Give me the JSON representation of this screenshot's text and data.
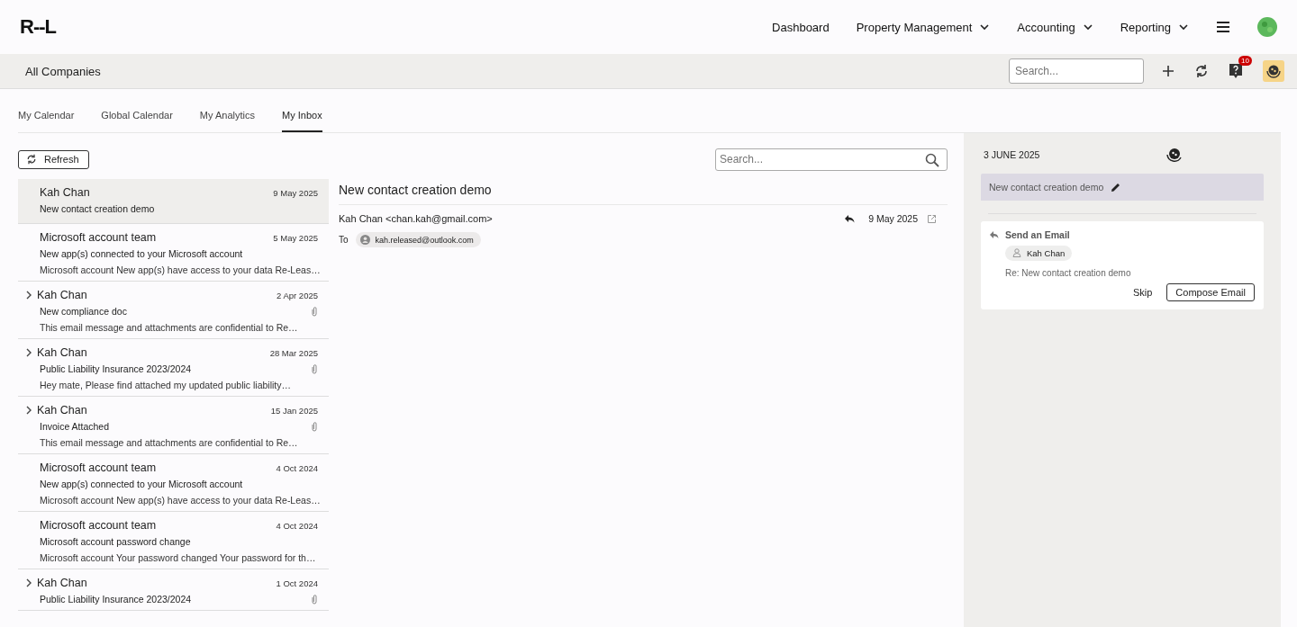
{
  "header": {
    "logo": "R--L",
    "nav": [
      {
        "label": "Dashboard",
        "dropdown": false
      },
      {
        "label": "Property Management",
        "dropdown": true
      },
      {
        "label": "Accounting",
        "dropdown": true
      },
      {
        "label": "Reporting",
        "dropdown": true
      }
    ]
  },
  "subbar": {
    "company": "All Companies",
    "search": {
      "placeholder": "Search..."
    },
    "help_badge": "10"
  },
  "tabs": [
    {
      "label": "My Calendar",
      "selected": false
    },
    {
      "label": "Global Calendar",
      "selected": false
    },
    {
      "label": "My Analytics",
      "selected": false
    },
    {
      "label": "My Inbox",
      "selected": true
    }
  ],
  "inbox": {
    "refresh": "Refresh",
    "search": {
      "placeholder": "Search..."
    },
    "emails": [
      {
        "sender": "Kah Chan",
        "date": "9 May 2025",
        "subject": "New contact creation demo",
        "selected": true,
        "expandable": false,
        "attachment": false
      },
      {
        "sender": "Microsoft account team",
        "date": "5 May 2025",
        "subject": "New app(s) connected to your Microsoft account",
        "preview": "Microsoft account New app(s) have access to your data Re-Leas…",
        "selected": false,
        "expandable": false,
        "attachment": false
      },
      {
        "sender": "Kah Chan",
        "date": "2 Apr 2025",
        "subject": "New compliance doc",
        "preview": "This email message and attachments are confidential to Re…",
        "selected": false,
        "expandable": true,
        "attachment": true
      },
      {
        "sender": "Kah Chan",
        "date": "28 Mar 2025",
        "subject": "Public Liability Insurance 2023/2024",
        "preview": "Hey mate, Please find attached my updated public liability…",
        "selected": false,
        "expandable": true,
        "attachment": true
      },
      {
        "sender": "Kah Chan",
        "date": "15 Jan 2025",
        "subject": "Invoice Attached",
        "preview": "This email message and attachments are confidential to Re…",
        "selected": false,
        "expandable": true,
        "attachment": true
      },
      {
        "sender": "Microsoft account team",
        "date": "4 Oct 2024",
        "subject": "New app(s) connected to your Microsoft account",
        "preview": "Microsoft account New app(s) have access to your data Re-Leas…",
        "selected": false,
        "expandable": false,
        "attachment": false
      },
      {
        "sender": "Microsoft account team",
        "date": "4 Oct 2024",
        "subject": "Microsoft account password change",
        "preview": "Microsoft account Your password changed Your password for th…",
        "selected": false,
        "expandable": false,
        "attachment": false
      },
      {
        "sender": "Kah Chan",
        "date": "1 Oct 2024",
        "subject": "Public Liability Insurance 2023/2024",
        "selected": false,
        "expandable": true,
        "attachment": true
      }
    ]
  },
  "message": {
    "subject": "New contact creation demo",
    "from": "Kah Chan <chan.kah@gmail.com>",
    "date": "9 May 2025",
    "to_label": "To",
    "to": "kah.released@outlook.com"
  },
  "panel": {
    "date": "3 JUNE 2025",
    "title": "New contact creation demo",
    "task": {
      "title": "Send an Email",
      "contact": "Kah Chan",
      "subject": "Re: New contact creation demo",
      "actions": [
        "Skip",
        "Compose Email"
      ]
    }
  }
}
